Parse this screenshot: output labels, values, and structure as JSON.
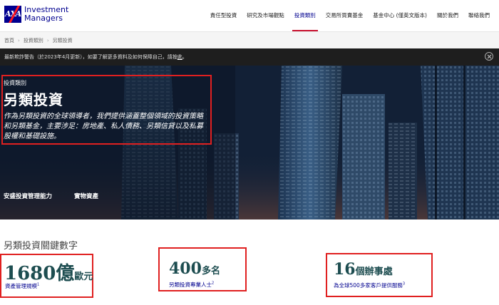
{
  "header": {
    "logo_mark": "AXA",
    "logo_line1": "Investment",
    "logo_line2": "Managers",
    "nav": [
      {
        "label": "責任型投資",
        "active": false
      },
      {
        "label": "研究及市場觀點",
        "active": false
      },
      {
        "label": "投資類別",
        "active": true
      },
      {
        "label": "交易所買賣基金",
        "active": false
      },
      {
        "label": "基金中心 (僅英文版本)",
        "active": false
      },
      {
        "label": "關於我們",
        "active": false
      },
      {
        "label": "聯絡我們",
        "active": false
      }
    ]
  },
  "breadcrumb": [
    "首頁",
    "投資類別",
    "另類投資"
  ],
  "notice": {
    "text": "最新欺詐警告（於2023年4月更新），如要了解更多資料及如何保障自己，請按",
    "link": "此",
    "end": "。"
  },
  "hero": {
    "eyebrow": "投資類別",
    "title": "另類投資",
    "description": "作為另類投資的全球領導者，我們提供涵蓋整個領域的投資策略和另類基金，主要涉足：房地產、私人債務、另類信貸以及私募股權和基礎設施。",
    "tabs": [
      "安盛投資管理能力",
      "實物資產"
    ]
  },
  "stats": {
    "heading": "另類投資關鍵數字",
    "items": [
      {
        "value": "1680億",
        "unit": "歐元",
        "label": "資產管理規模",
        "note": "1"
      },
      {
        "value": "400",
        "unit": "多名",
        "label": "另類投資專業人士",
        "note": "2"
      },
      {
        "value": "16",
        "unit": "個辦事處",
        "label": "為全球500多家客戶提供服務",
        "note": "3"
      }
    ]
  },
  "colors": {
    "brand_blue": "#00008f",
    "brand_red": "#ff1721",
    "stat_teal": "#1d4d50",
    "highlight_red": "#e02020"
  }
}
